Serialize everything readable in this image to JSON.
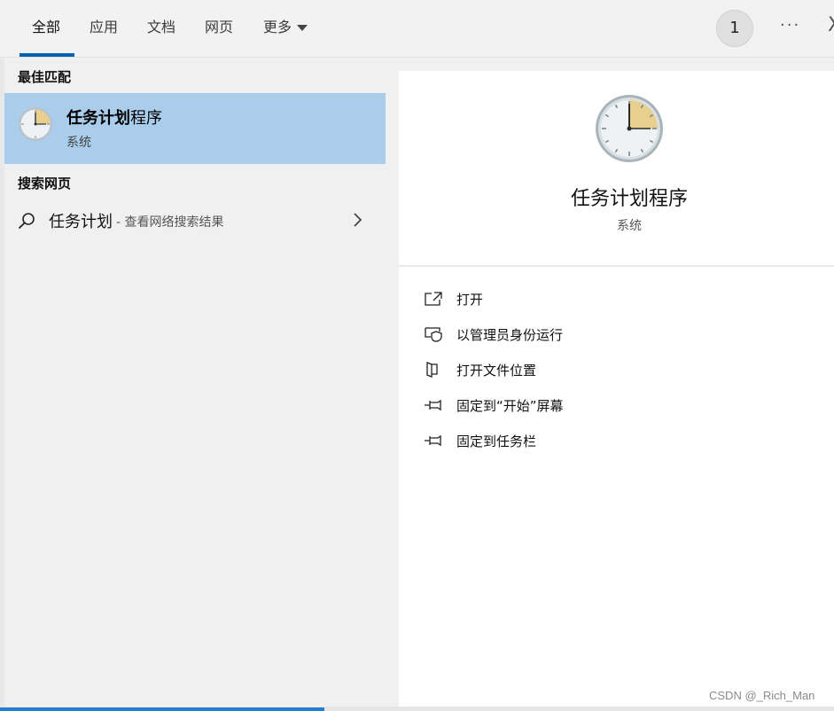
{
  "tabs": [
    {
      "label": "全部",
      "active": true
    },
    {
      "label": "应用"
    },
    {
      "label": "文档"
    },
    {
      "label": "网页"
    },
    {
      "label": "更多"
    }
  ],
  "header": {
    "badge_count": "1",
    "more_options": "···",
    "close": "X"
  },
  "best_match": {
    "heading": "最佳匹配",
    "title_bold": "任务计划",
    "title_rest": "程序",
    "subtitle": "系统"
  },
  "web_search": {
    "heading": "搜索网页",
    "term": "任务计划",
    "description": "- 查看网络搜索结果"
  },
  "detail": {
    "title": "任务计划程序",
    "subtitle": "系统",
    "actions": [
      {
        "label": "打开",
        "icon": "open-icon"
      },
      {
        "label": "以管理员身份运行",
        "icon": "shield-icon"
      },
      {
        "label": "打开文件位置",
        "icon": "folder-icon"
      },
      {
        "label": "固定到“开始”屏幕",
        "icon": "pin-icon"
      },
      {
        "label": "固定到任务栏",
        "icon": "pin-icon"
      }
    ]
  },
  "watermark": "CSDN @_Rich_Man",
  "colors": {
    "accent": "#0063b1",
    "selection": "#aacdec",
    "clock_face": "#eef2f4",
    "clock_wedge": "#e8cf8e"
  }
}
